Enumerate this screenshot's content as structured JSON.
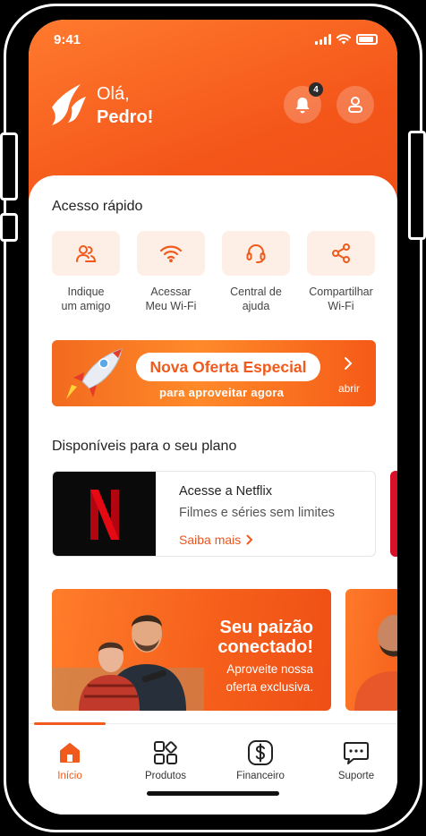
{
  "status": {
    "time": "9:41"
  },
  "header": {
    "greeting_line1": "Olá,",
    "greeting_name": "Pedro!",
    "notification_count": "4"
  },
  "quick_access": {
    "title": "Acesso rápido",
    "items": [
      {
        "label": "Indique\num amigo",
        "icon": "users-icon"
      },
      {
        "label": "Acessar\nMeu Wi-Fi",
        "icon": "wifi-icon"
      },
      {
        "label": "Central de\najuda",
        "icon": "headset-icon"
      },
      {
        "label": "Compartilhar\nWi-Fi",
        "icon": "share-icon"
      }
    ]
  },
  "promo": {
    "title": "Nova Oferta Especial",
    "subtitle": "para aproveitar agora",
    "action": "abrir"
  },
  "plan": {
    "title": "Disponíveis para o seu plano",
    "card": {
      "title": "Acesse a Netflix",
      "subtitle": "Filmes e séries sem limites",
      "link": "Saiba mais"
    }
  },
  "banner": {
    "headline": "Seu paizão\nconectado!",
    "text": "Aproveite nossa\noferta exclusiva."
  },
  "tabs": [
    {
      "label": "Início",
      "icon": "home-icon",
      "active": true
    },
    {
      "label": "Produtos",
      "icon": "products-icon"
    },
    {
      "label": "Financeiro",
      "icon": "dollar-icon"
    },
    {
      "label": "Suporte",
      "icon": "chat-icon"
    }
  ],
  "colors": {
    "accent": "#f05a1c",
    "tile_bg": "#fdeee6",
    "netflix_red": "#e50914"
  }
}
